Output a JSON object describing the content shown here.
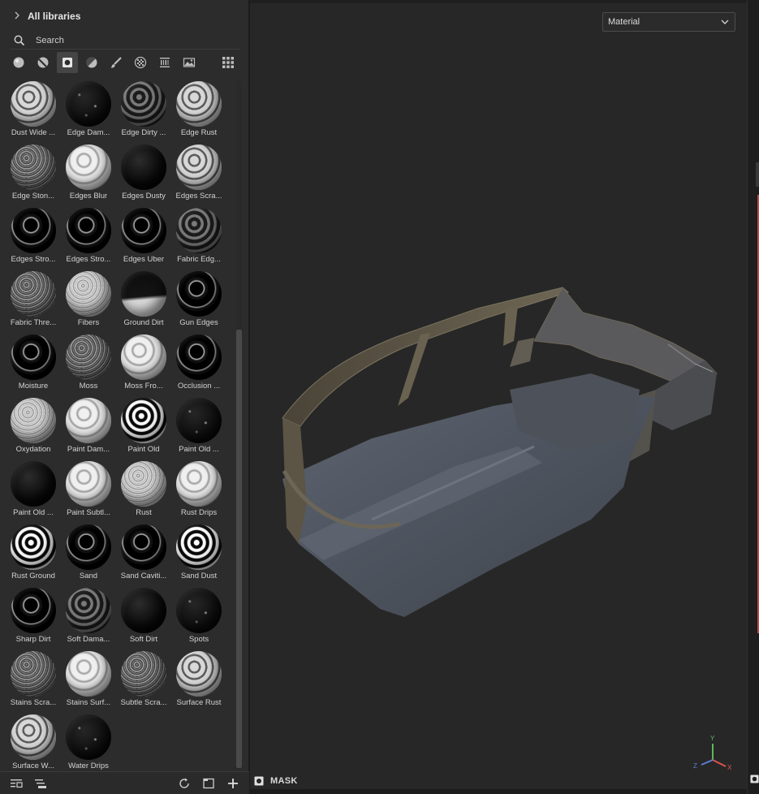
{
  "shelf": {
    "library_title": "All libraries",
    "search_placeholder": "Search",
    "filters": [
      {
        "name": "filter-materials-icon",
        "active": false
      },
      {
        "name": "filter-smart-materials-icon",
        "active": false
      },
      {
        "name": "filter-smart-masks-icon",
        "active": true
      },
      {
        "name": "filter-filters-icon",
        "active": false
      },
      {
        "name": "filter-brushes-icon",
        "active": false
      },
      {
        "name": "filter-alphas-icon",
        "active": false
      },
      {
        "name": "filter-grunges-icon",
        "active": false
      },
      {
        "name": "filter-environments-icon",
        "active": false
      }
    ],
    "items": [
      {
        "label": "Dust Wide ...",
        "style": "stripes"
      },
      {
        "label": "Edge Dam...",
        "style": "dark-speckle"
      },
      {
        "label": "Edge Dirty ...",
        "style": "dark-stripes"
      },
      {
        "label": "Edge Rust",
        "style": "stripes"
      },
      {
        "label": "Edge Ston...",
        "style": "noise"
      },
      {
        "label": "Edges Blur",
        "style": "light"
      },
      {
        "label": "Edges Dusty",
        "style": "black"
      },
      {
        "label": "Edges Scra...",
        "style": "stripes"
      },
      {
        "label": "Edges Stro...",
        "style": "black-stripes"
      },
      {
        "label": "Edges Stro...",
        "style": "black-stripes"
      },
      {
        "label": "Edges Uber",
        "style": "black-stripes"
      },
      {
        "label": "Fabric Edg...",
        "style": "dark-stripes"
      },
      {
        "label": "Fabric Thre...",
        "style": "noise"
      },
      {
        "label": "Fibers",
        "style": "light-noise"
      },
      {
        "label": "Ground Dirt",
        "style": "ground"
      },
      {
        "label": "Gun Edges",
        "style": "black-stripes"
      },
      {
        "label": "Moisture",
        "style": "black-stripes"
      },
      {
        "label": "Moss",
        "style": "noise"
      },
      {
        "label": "Moss Fro...",
        "style": "light"
      },
      {
        "label": "Occlusion ...",
        "style": "black-stripes"
      },
      {
        "label": "Oxydation",
        "style": "light-noise"
      },
      {
        "label": "Paint Dam...",
        "style": "light"
      },
      {
        "label": "Paint Old",
        "style": "contrast"
      },
      {
        "label": "Paint Old ...",
        "style": "dark-speckle"
      },
      {
        "label": "Paint Old ...",
        "style": "black"
      },
      {
        "label": "Paint Subtl...",
        "style": "light"
      },
      {
        "label": "Rust",
        "style": "light-noise"
      },
      {
        "label": "Rust Drips",
        "style": "light"
      },
      {
        "label": "Rust Ground",
        "style": "contrast"
      },
      {
        "label": "Sand",
        "style": "black-stripes"
      },
      {
        "label": "Sand Caviti...",
        "style": "black-stripes"
      },
      {
        "label": "Sand Dust",
        "style": "contrast"
      },
      {
        "label": "Sharp Dirt",
        "style": "black-stripes"
      },
      {
        "label": "Soft Dama...",
        "style": "dark-stripes"
      },
      {
        "label": "Soft Dirt",
        "style": "black"
      },
      {
        "label": "Spots",
        "style": "dark-speckle"
      },
      {
        "label": "Stains Scra...",
        "style": "noise"
      },
      {
        "label": "Stains Surf...",
        "style": "light"
      },
      {
        "label": "Subtle Scra...",
        "style": "noise"
      },
      {
        "label": "Surface Rust",
        "style": "stripes"
      },
      {
        "label": "Surface W...",
        "style": "stripes"
      },
      {
        "label": "Water Drips",
        "style": "dark-speckle"
      }
    ]
  },
  "viewport": {
    "mode_select": "Material",
    "mask_label": "MASK",
    "gizmo": {
      "y": "Y",
      "x": "X",
      "z": "Z"
    }
  },
  "colors": {
    "panel_bg": "#2c2c2c",
    "viewport_bg": "#272727",
    "axis_x": "#d9534f",
    "axis_y": "#5cb85c",
    "axis_z": "#5b7fd6"
  }
}
